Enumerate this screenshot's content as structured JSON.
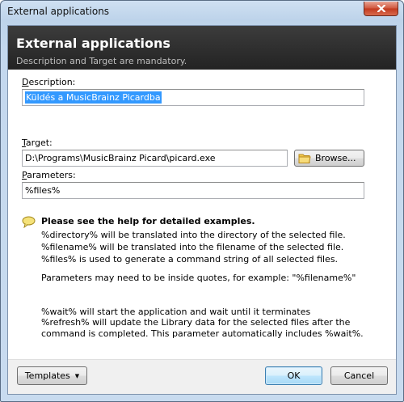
{
  "window": {
    "title": "External applications",
    "close_icon": "close-icon"
  },
  "header": {
    "title": "External applications",
    "subtitle": "Description and Target are mandatory."
  },
  "description": {
    "label_accel": "D",
    "label_rest": "escription:",
    "value": "Küldés a MusicBrainz Picardba"
  },
  "target": {
    "label_accel": "T",
    "label_rest": "arget:",
    "value": "D:\\Programs\\MusicBrainz Picard\\picard.exe",
    "browse_label": "Browse...",
    "browse_icon": "folder-icon"
  },
  "parameters": {
    "label_accel": "P",
    "label_rest": "arameters:",
    "value": "%files%"
  },
  "help": {
    "icon": "speech-bubble-icon",
    "heading": "Please see the help for detailed examples.",
    "line1": "%directory% will be translated into the directory of the selected file.",
    "line2": "%filename% will be translated into the filename of the selected file.",
    "line3": "%files% is used to generate a command string of all selected files.",
    "line4": "Parameters may need to be inside quotes, for example: \"%filename%\"",
    "line5": "%wait% will start the application and wait until it terminates",
    "line6": "%refresh% will update the Library data for the selected files after the",
    "line7": "command is completed. This parameter automatically includes %wait%."
  },
  "footer": {
    "templates_label": "Templates",
    "ok_label": "OK",
    "cancel_label": "Cancel"
  },
  "colors": {
    "header_bg": "#2e2e2e",
    "selection": "#3399ff",
    "close_button": "#c2391e"
  }
}
